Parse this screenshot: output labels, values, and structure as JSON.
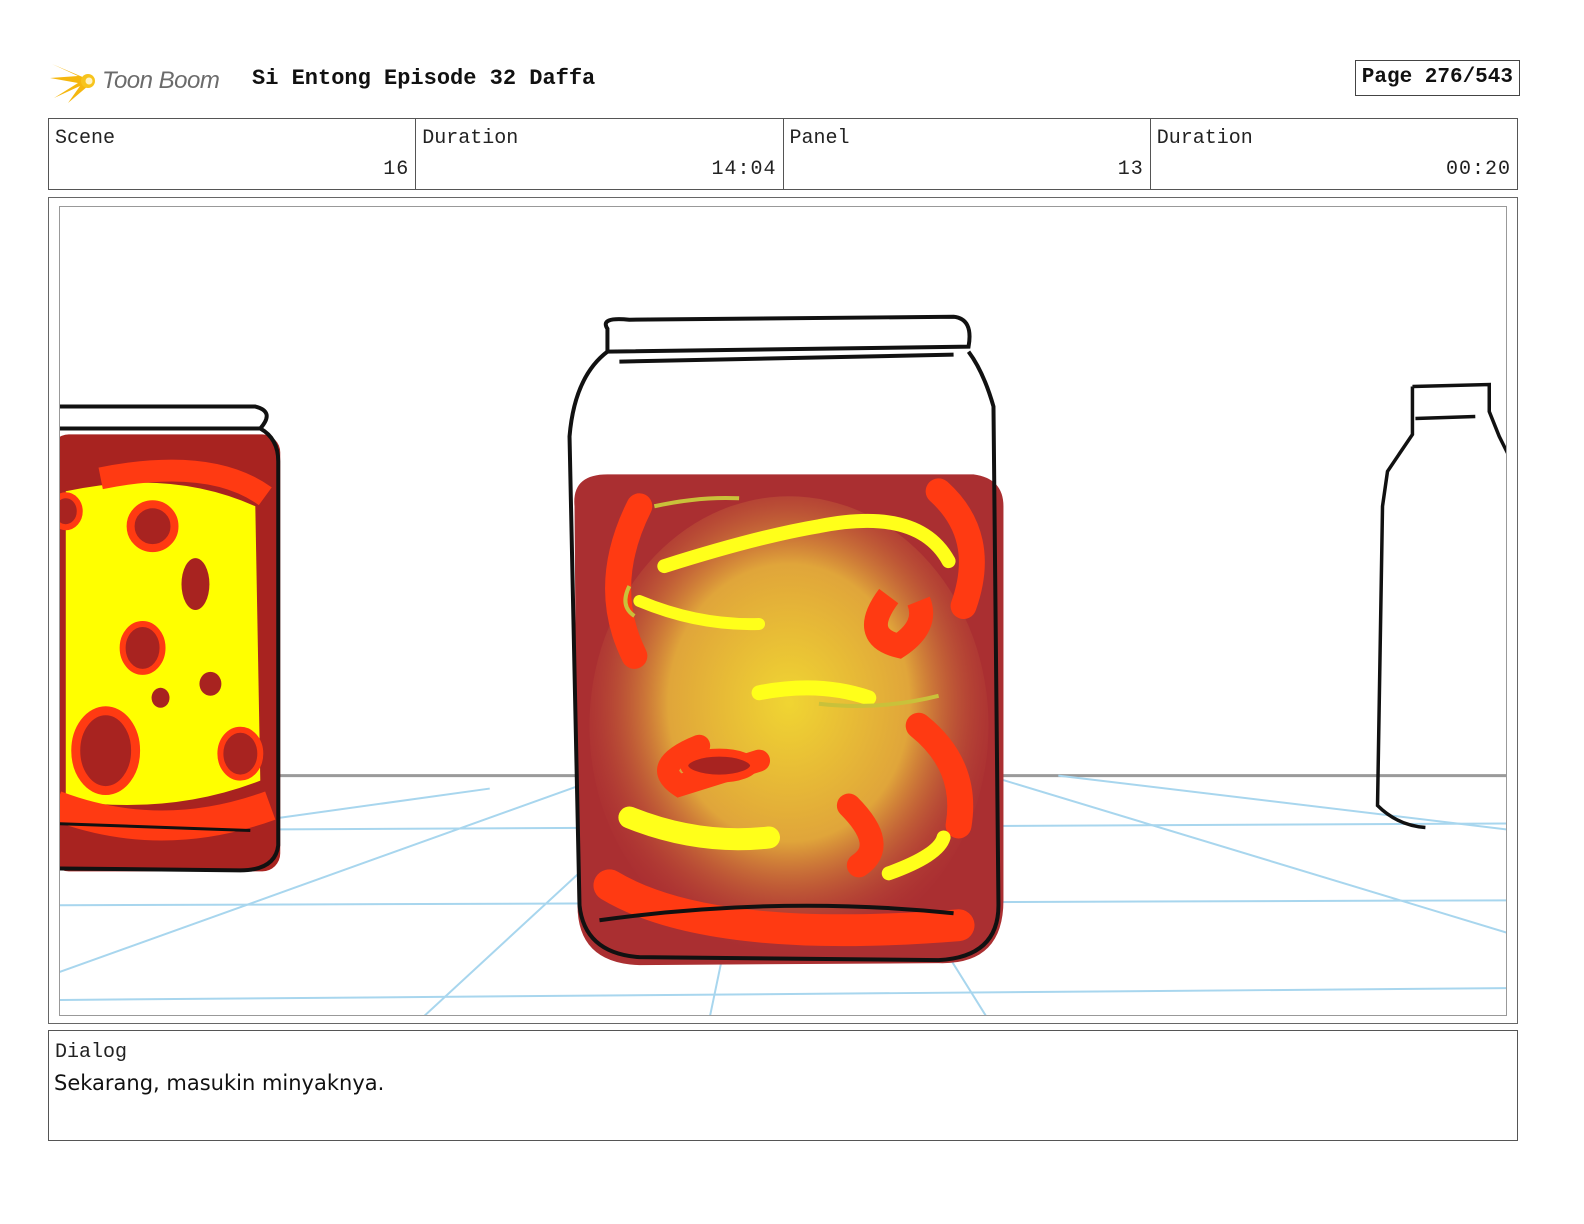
{
  "header": {
    "brand": "Toon Boom",
    "title": "Si Entong Episode 32 Daffa",
    "page": "Page 276/543"
  },
  "info": {
    "scene_label": "Scene",
    "scene_value": "16",
    "scene_duration_label": "Duration",
    "scene_duration_value": "14:04",
    "panel_label": "Panel",
    "panel_value": "13",
    "panel_duration_label": "Duration",
    "panel_duration_value": "00:20"
  },
  "dialog": {
    "label": "Dialog",
    "text": "Sekarang, masukin minyaknya."
  },
  "colors": {
    "brand_gold": "#f2b316",
    "jar_liquid": "#a9282b",
    "chili_red": "#ff3a12",
    "chili_yellow": "#ffff00",
    "floor_grid": "#9fd3ec"
  }
}
